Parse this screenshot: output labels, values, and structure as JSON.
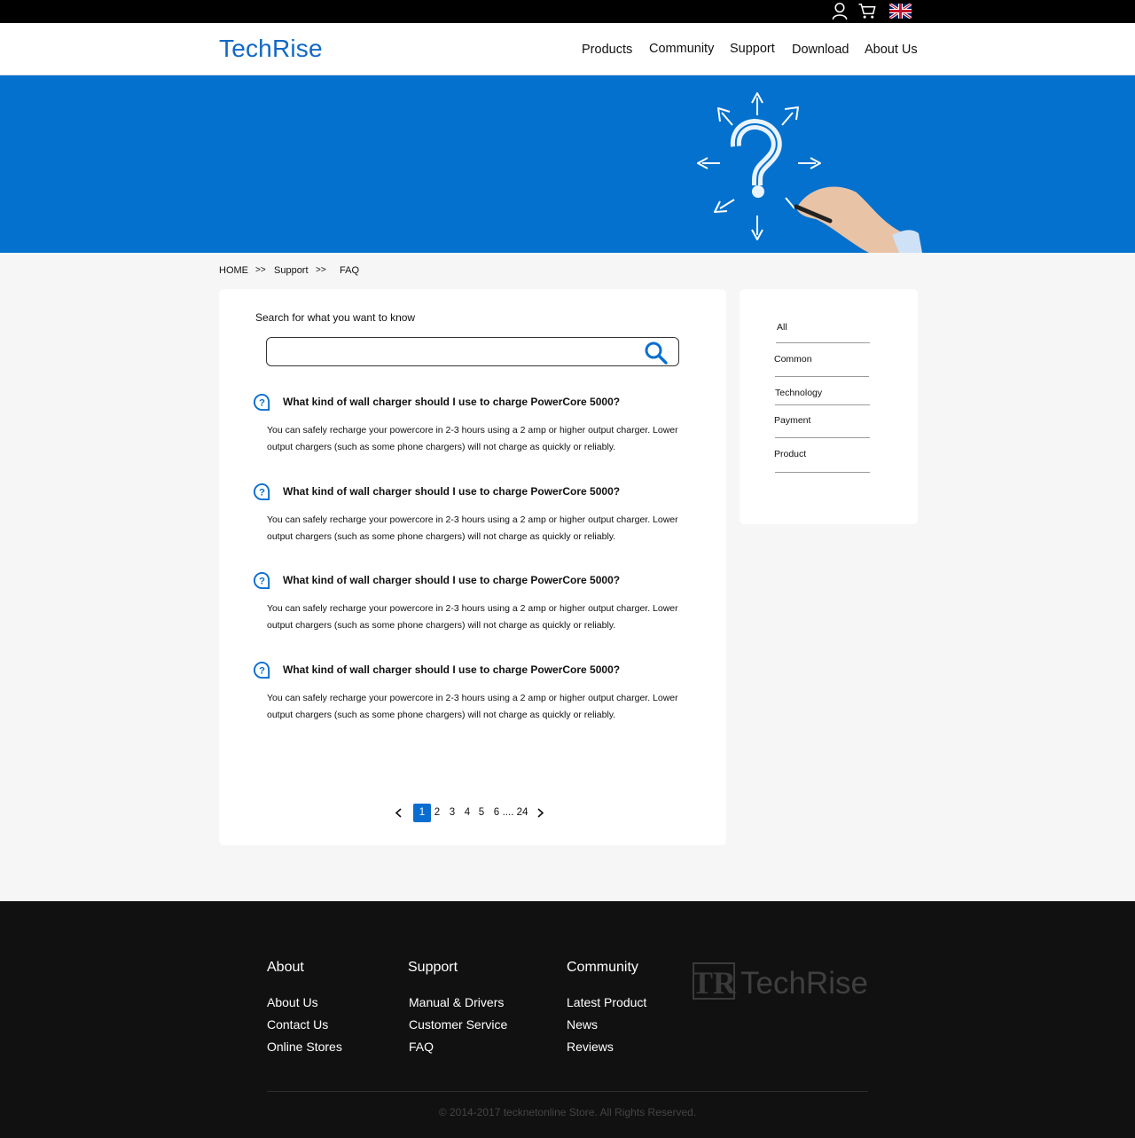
{
  "brand": {
    "name": "TechRise",
    "accent_color": "#0371cd",
    "logo_color": "#1168c6"
  },
  "topbar": {
    "icons": [
      "user-icon",
      "cart-icon",
      "uk-flag-icon"
    ]
  },
  "nav": {
    "items": [
      "Products",
      "Community",
      "Support",
      "Download",
      "About Us"
    ]
  },
  "breadcrumb": {
    "home": "HOME",
    "sep1": ">>",
    "support": "Support",
    "sep2": ">>",
    "current": "FAQ"
  },
  "search": {
    "label": "Search for what you want to know",
    "value": "",
    "placeholder": ""
  },
  "faqs": [
    {
      "question": "What kind of wall charger should I use to charge PowerCore 5000?",
      "answer": "You can safely recharge your powercore in 2-3 hours using a 2 amp or higher output charger. Lower output chargers (such as some phone chargers) will not charge as quickly or reliably."
    },
    {
      "question": "What kind of wall charger should I use to charge PowerCore 5000?",
      "answer": "You can safely recharge your powercore in 2-3 hours using a 2 amp or higher output charger. Lower output chargers (such as some phone chargers) will not charge as quickly or reliably."
    },
    {
      "question": "What kind of wall charger should I use to charge PowerCore 5000?",
      "answer": "You can safely recharge your powercore in 2-3 hours using a 2 amp or higher output charger. Lower output chargers (such as some phone chargers) will not charge as quickly or reliably."
    },
    {
      "question": "What kind of wall charger should I use to charge PowerCore 5000?",
      "answer": "You can safely recharge your powercore in 2-3 hours using a 2 amp or higher output charger. Lower output chargers (such as some phone chargers) will not charge as quickly or reliably."
    }
  ],
  "pagination": {
    "current": "1",
    "pages": [
      "1",
      "2",
      "3",
      "4",
      "5",
      "6"
    ],
    "ellipsis": "....",
    "last": "24"
  },
  "categories": [
    "All",
    "Common",
    "Technology",
    "Payment",
    "Product"
  ],
  "footer": {
    "columns": [
      {
        "heading": "About",
        "links": [
          "About Us",
          "Contact Us",
          "Online Stores"
        ]
      },
      {
        "heading": "Support",
        "links": [
          "Manual & Drivers",
          "Customer Service",
          "FAQ"
        ]
      },
      {
        "heading": "Community",
        "links": [
          "Latest Product",
          "News",
          "Reviews"
        ]
      }
    ],
    "logo_mark": "TR",
    "logo_text": "TechRise",
    "copyright": "© 2014-2017 tecknetonline Store. All Rights Reserved."
  }
}
